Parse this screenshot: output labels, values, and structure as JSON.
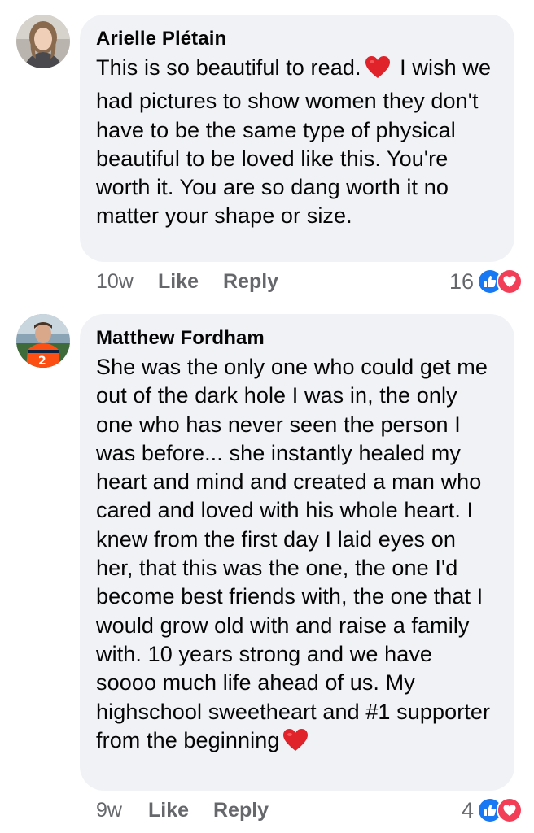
{
  "comments": [
    {
      "author": "Arielle Plétain",
      "text_before_emoji": "This is so beautiful to read.",
      "text_after_emoji": " I wish we had pictures to show women they don't have to be the same type of physical beautiful to be loved like this. You're worth it. You are so dang worth it no matter your shape or size.",
      "emoji": "red-heart",
      "time": "10w",
      "like_label": "Like",
      "reply_label": "Reply",
      "reaction_count": "16",
      "reactions": [
        "like",
        "love"
      ]
    },
    {
      "author": "Matthew Fordham",
      "text_before_emoji": "She was the only one who could get me out of the dark hole I was in, the only one who has never seen the person I was before... she instantly healed my heart and mind and created a man who cared and loved with his whole heart. I knew from the first day I laid eyes on her, that this was the one, the one I'd become best friends with, the one that I would grow old with and raise a family with. 10 years strong and we have soooo much life ahead of us. My highschool sweetheart and #1 supporter from the beginning",
      "text_after_emoji": "",
      "emoji": "red-heart",
      "time": "9w",
      "like_label": "Like",
      "reply_label": "Reply",
      "reaction_count": "4",
      "reactions": [
        "like",
        "love"
      ]
    }
  ],
  "colors": {
    "bubble": "#f0f2f5",
    "meta_text": "#65676b",
    "like_blue": "#1877f2",
    "love_red": "#f33e58",
    "heart_emoji": "#e0222a"
  }
}
